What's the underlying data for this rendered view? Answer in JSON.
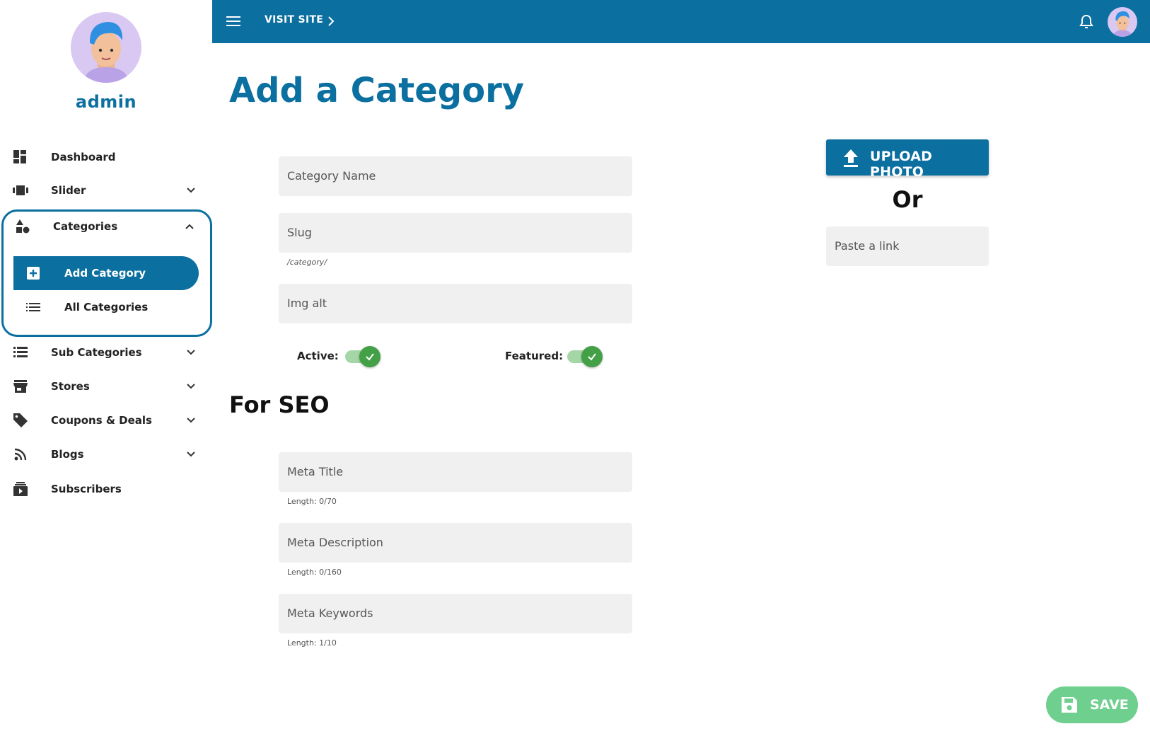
{
  "profile": {
    "name": "admin"
  },
  "topbar": {
    "visit_site": "VISIT SITE"
  },
  "sidebar": {
    "items": [
      {
        "label": "Dashboard"
      },
      {
        "label": "Slider"
      },
      {
        "label": "Categories"
      },
      {
        "label": "Sub Categories"
      },
      {
        "label": "Stores"
      },
      {
        "label": "Coupons & Deals"
      },
      {
        "label": "Blogs"
      },
      {
        "label": "Subscribers"
      }
    ],
    "categories_sub": [
      {
        "label": "Add Category"
      },
      {
        "label": "All Categories"
      }
    ]
  },
  "main": {
    "title": "Add a Category",
    "fields": {
      "category_name": {
        "placeholder": "Category Name"
      },
      "slug": {
        "placeholder": "Slug",
        "helper": "/category/"
      },
      "img_alt": {
        "placeholder": "Img alt"
      }
    },
    "toggles": {
      "active_label": "Active:",
      "featured_label": "Featured:"
    },
    "seo": {
      "title": "For SEO",
      "meta_title": {
        "placeholder": "Meta Title",
        "helper": "Length: 0/70"
      },
      "meta_description": {
        "placeholder": "Meta Description",
        "helper": "Length: 0/160"
      },
      "meta_keywords": {
        "placeholder": "Meta Keywords",
        "helper": "Length: 1/10"
      }
    }
  },
  "upload": {
    "button_label": "UPLOAD PHOTO",
    "or_text": "Or",
    "link_placeholder": "Paste a link"
  },
  "actions": {
    "save_label": "SAVE"
  },
  "colors": {
    "primary": "#0b6fa0",
    "success": "#43a047",
    "save_bg": "#6fcf8e"
  }
}
